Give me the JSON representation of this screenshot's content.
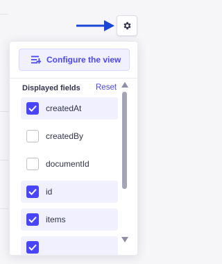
{
  "toolbar": {
    "settings_icon": "gear-icon",
    "pointer_icon": "arrow-right-icon",
    "pointer_color": "#1a47d6"
  },
  "popover": {
    "configure_label": "Configure the view",
    "configure_icon": "list-settings-icon",
    "fields_title": "Displayed fields",
    "reset_label": "Reset",
    "accent": "#4945ff",
    "fields": [
      {
        "label": "createdAt",
        "checked": true
      },
      {
        "label": "createdBy",
        "checked": false
      },
      {
        "label": "documentId",
        "checked": false
      },
      {
        "label": "id",
        "checked": true
      },
      {
        "label": "items",
        "checked": true
      },
      {
        "label": "",
        "checked": true
      }
    ]
  }
}
